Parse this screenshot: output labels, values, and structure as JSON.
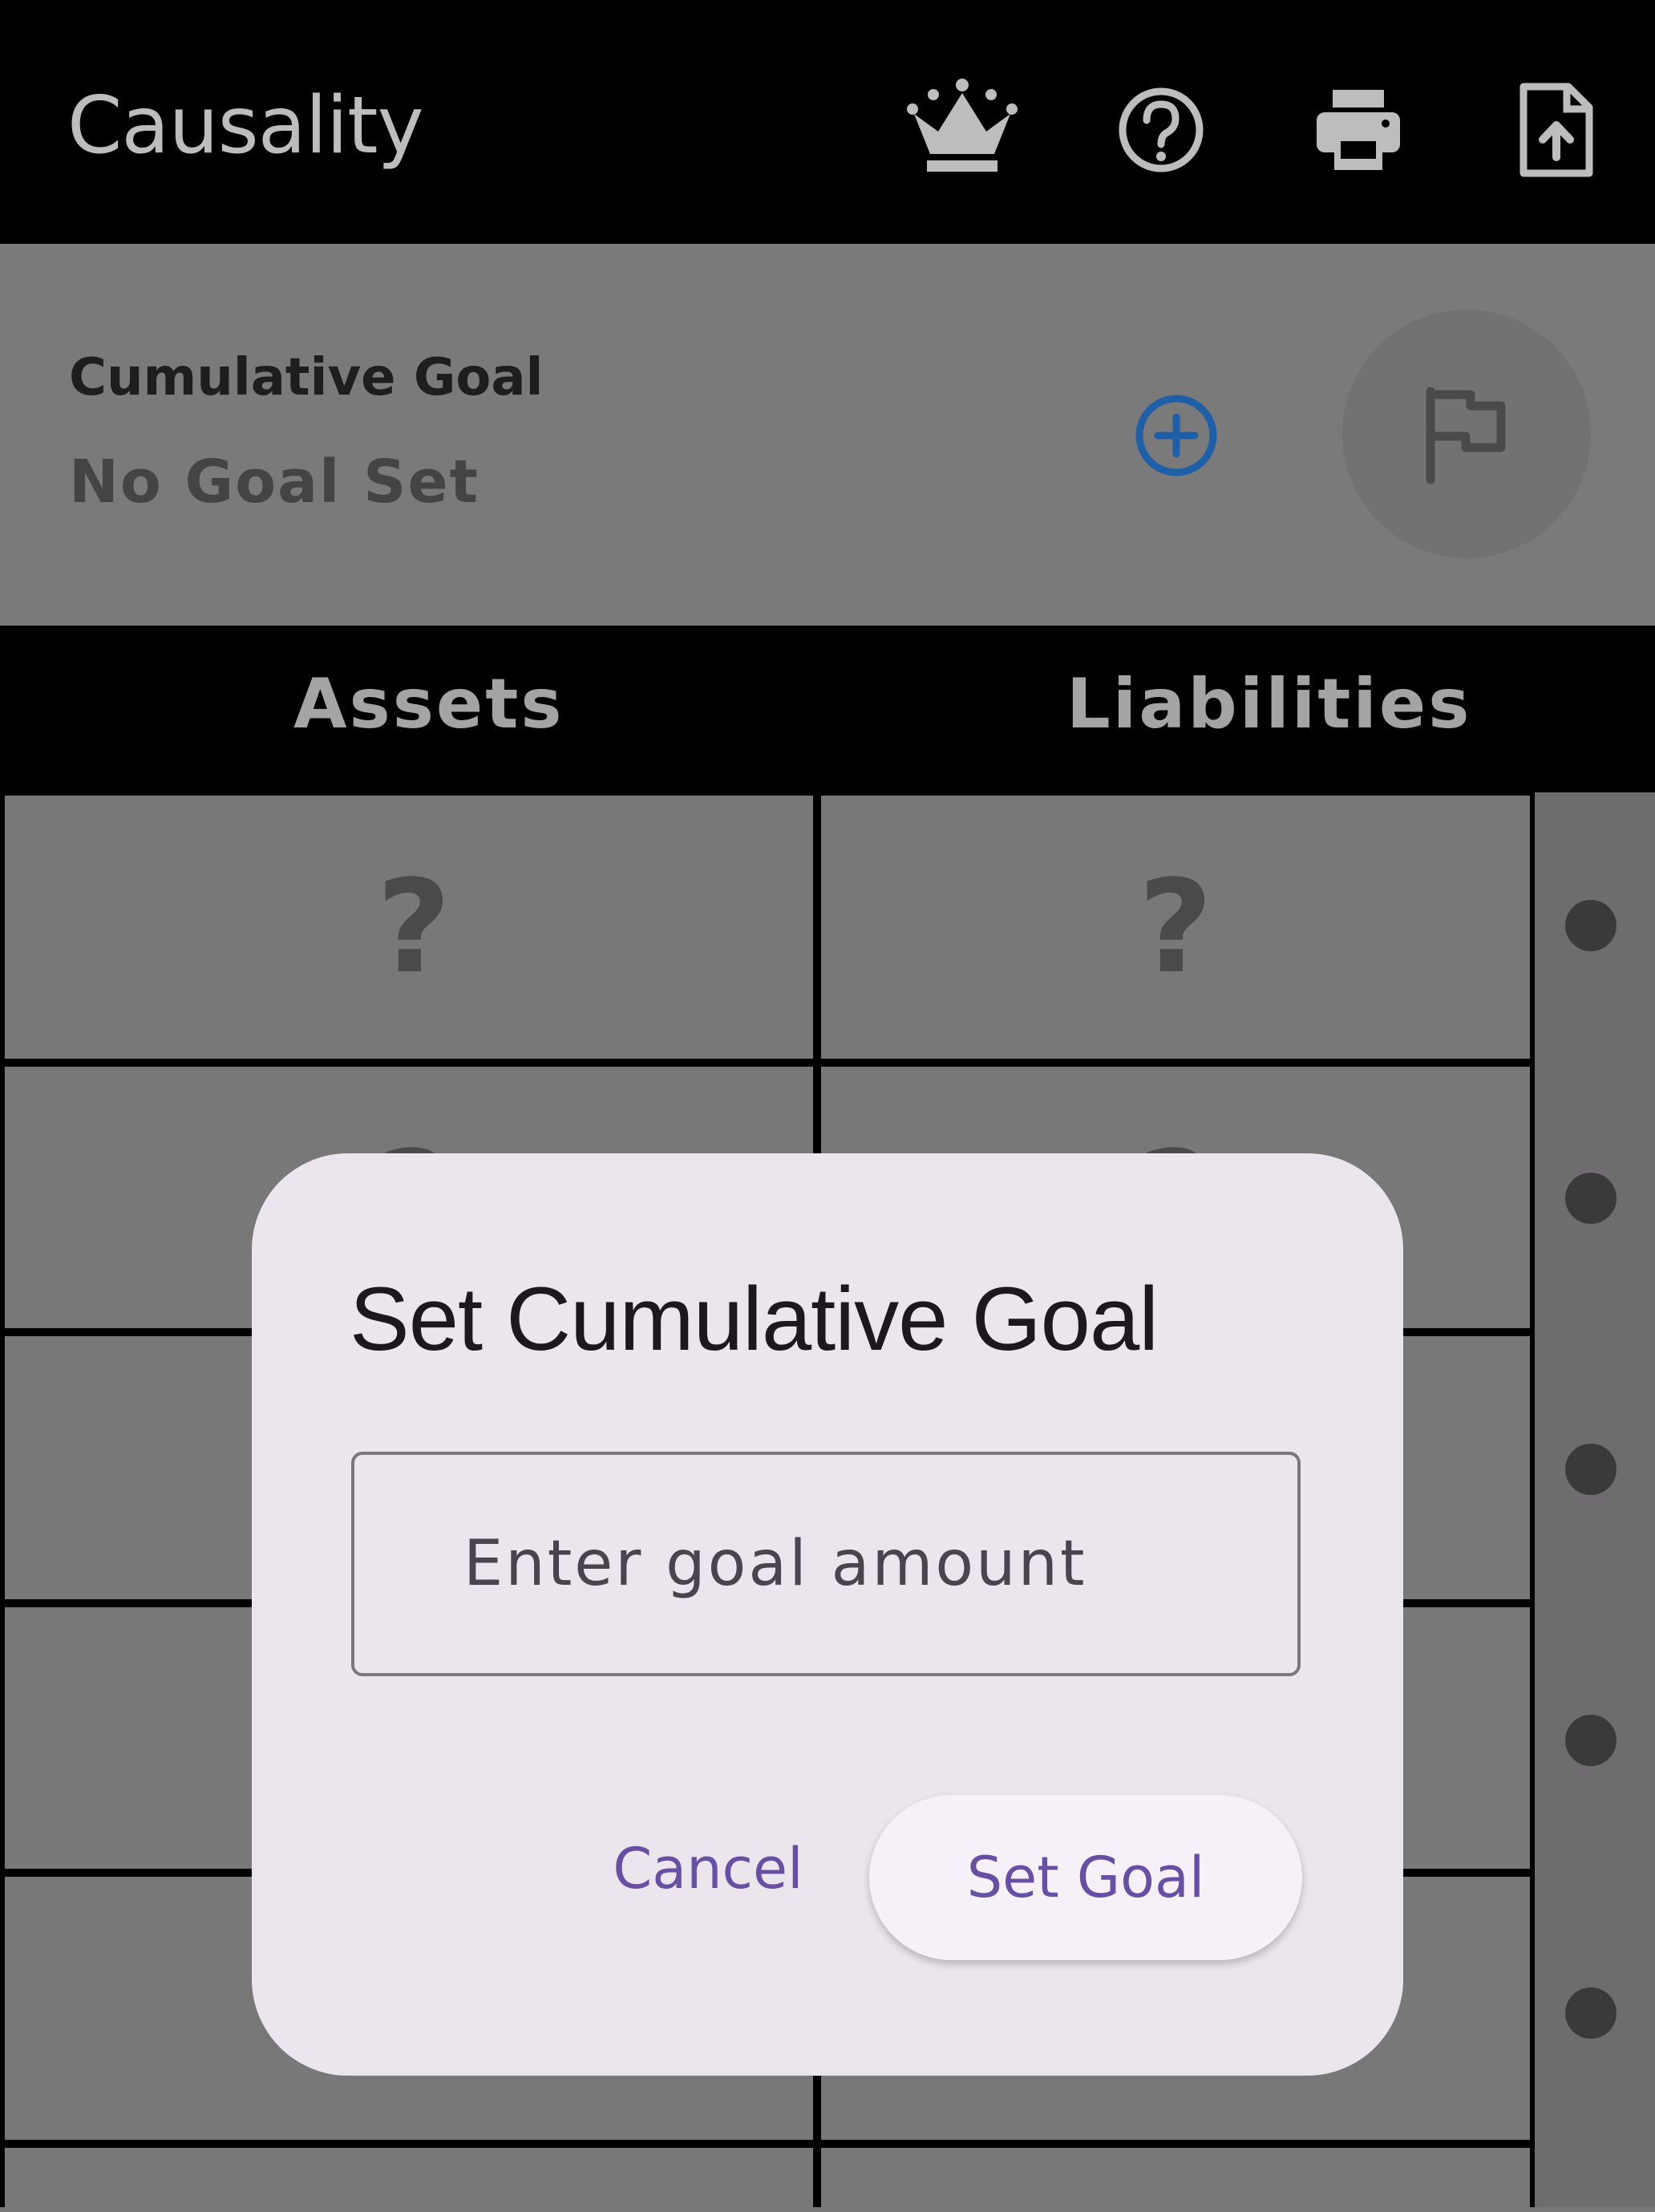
{
  "app": {
    "title": "Causality",
    "icons": [
      "crown-icon",
      "help-icon",
      "print-icon",
      "export-file-icon"
    ]
  },
  "goal_panel": {
    "label": "Cumulative Goal",
    "value": "No Goal Set",
    "add_icon": "add-circle-icon",
    "flag_icon": "flag-icon"
  },
  "tabs": [
    "Assets",
    "Liabilities"
  ],
  "grid": {
    "placeholder": "?"
  },
  "dialog": {
    "title": "Set Cumulative Goal",
    "input_placeholder": "Enter goal amount",
    "input_value": "",
    "cancel_label": "Cancel",
    "confirm_label": "Set Goal"
  },
  "colors": {
    "accent": "#6750a4",
    "add_icon": "#1e5fa8",
    "dialog_bg": "#ebe6ee",
    "scrim": "#777777"
  }
}
